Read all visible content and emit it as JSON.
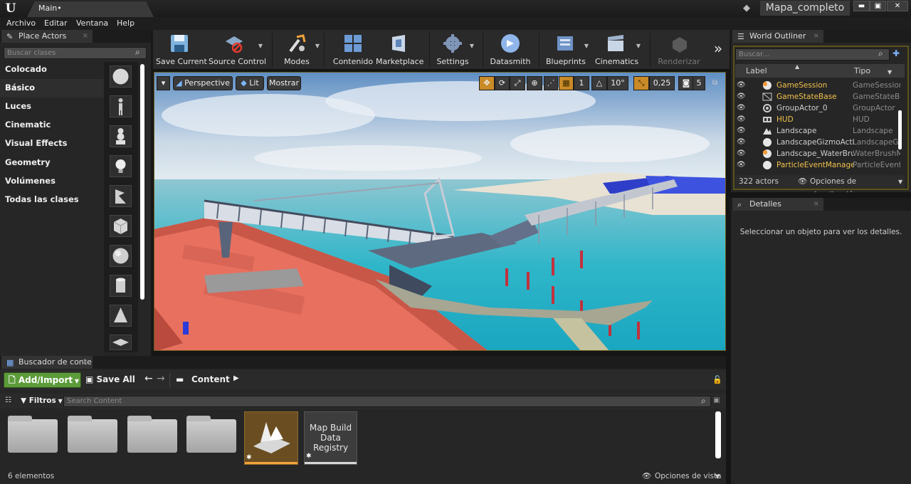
{
  "window": {
    "tab_title": "Main",
    "tab_modified": "•",
    "project_name": "Mapa_completo",
    "buttons": {
      "minimize": "▬",
      "maximize": "▣",
      "close": "✕"
    }
  },
  "menu": [
    "Archivo",
    "Editar",
    "Ventana",
    "Help"
  ],
  "place_actors": {
    "tab_label": "Place Actors",
    "search_placeholder": "Buscar clases",
    "categories": [
      "Colocado recientemente",
      "Básico",
      "Luces",
      "Cinematic",
      "Visual Effects",
      "Geometry",
      "Volúmenes",
      "Todas las clases"
    ],
    "selected_category": "Básico"
  },
  "toolbar": {
    "save_current": "Save Current",
    "source_control": "Source Control",
    "modes": "Modes",
    "contenido": "Contenido",
    "marketplace": "Marketplace",
    "settings": "Settings",
    "datasmith": "Datasmith",
    "blueprints": "Blueprints",
    "cinematics": "Cinematics",
    "renderizar": "Renderizar",
    "more": "»"
  },
  "viewport": {
    "perspective": "Perspective",
    "lit": "Lit",
    "mostrar": "Mostrar",
    "grid_snap": "1",
    "rotation_snap": "10°",
    "scale_snap": "0,25",
    "camera_speed": "5"
  },
  "world_outliner": {
    "tab_label": "World Outliner",
    "search_placeholder": "Buscar...",
    "col_label": "Label",
    "col_type": "Tipo",
    "rows": [
      {
        "label": "GameSession",
        "type": "GameSession",
        "highlight": true
      },
      {
        "label": "GameStateBase",
        "type": "GameStateBase",
        "highlight": true
      },
      {
        "label": "GroupActor_0",
        "type": "GroupActor",
        "highlight": false
      },
      {
        "label": "HUD",
        "type": "HUD",
        "highlight": true
      },
      {
        "label": "Landscape",
        "type": "Landscape",
        "highlight": false
      },
      {
        "label": "LandscapeGizmoActiv",
        "type": "LandscapeGizmo",
        "highlight": false
      },
      {
        "label": "Landscape_WaterBrus",
        "type": "WaterBrushManager",
        "highlight": false
      },
      {
        "label": "ParticleEventManager",
        "type": "ParticleEventManager",
        "highlight": true
      }
    ],
    "actor_count": "322 actors",
    "view_options": "Opciones de visualización"
  },
  "details": {
    "tab_label": "Detalles",
    "empty_message": "Seleccionar un objeto para ver los detalles."
  },
  "content_browser": {
    "tab_label": "Buscador de conte",
    "add_import": "Add/Import",
    "save_all": "Save All",
    "path_root": "Content",
    "filters": "Filtros",
    "search_placeholder": "Search Content",
    "asset_label": "Map Build Data Registry",
    "status": "6 elementos",
    "view_options": "Opciones de vista"
  },
  "colors": {
    "accent": "#f0c04d",
    "add_import_green": "#5c9b3a",
    "panel": "#262626"
  }
}
